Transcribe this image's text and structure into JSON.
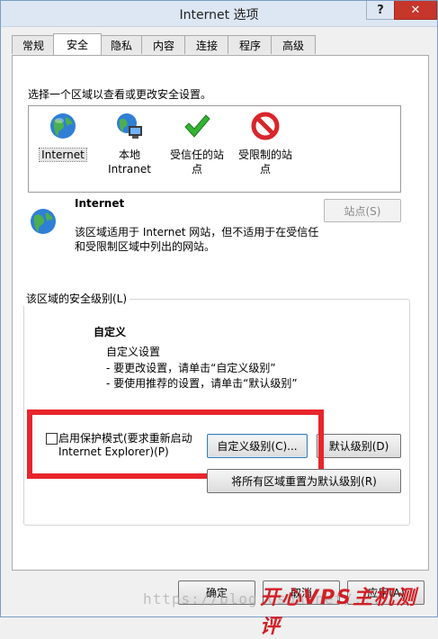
{
  "window": {
    "title": "Internet 选项",
    "help_glyph": "?",
    "close_glyph": "✕"
  },
  "tabs": [
    {
      "label": "常规"
    },
    {
      "label": "安全"
    },
    {
      "label": "隐私"
    },
    {
      "label": "内容"
    },
    {
      "label": "连接"
    },
    {
      "label": "程序"
    },
    {
      "label": "高级"
    }
  ],
  "security": {
    "instruction": "选择一个区域以查看或更改安全设置。",
    "zones": [
      {
        "line1": "Internet",
        "line2": "",
        "icon": "globe-icon"
      },
      {
        "line1": "本地",
        "line2": "Intranet",
        "icon": "intranet-icon"
      },
      {
        "line1": "受信任的站",
        "line2": "点",
        "icon": "checkmark-icon"
      },
      {
        "line1": "受限制的站",
        "line2": "点",
        "icon": "restricted-icon"
      }
    ],
    "selected_zone": {
      "name": "Internet",
      "description_1": "该区域适用于 Internet 网站，但不适用于在受信任",
      "description_2": "和受限制区域中列出的网站。"
    },
    "sites_button": "站点(S)",
    "level_group": {
      "legend": "该区域的安全级别(L)",
      "level_name": "自定义",
      "line1": "自定义设置",
      "line2": "- 要更改设置，请单击“自定义级别”",
      "line3": "- 要使用推荐的设置，请单击“默认级别”"
    },
    "protected_mode": {
      "label_1": "启用保护模式(要求重新启动",
      "label_2": "Internet Explorer)(P)",
      "checked": false
    },
    "custom_level_button": "自定义级别(C)...",
    "default_level_button": "默认级别(D)",
    "reset_all_button": "将所有区域重置为默认级别(R)"
  },
  "footer": {
    "ok": "确定",
    "cancel": "取消",
    "apply": "应用(A)"
  },
  "watermark": {
    "url": "https://blog.csdn.net/...",
    "brand": "开心VPS主机测评"
  },
  "colors": {
    "highlight_frame": "#e8262b",
    "titlebar": "#dce7f3",
    "close": "#c7362b"
  }
}
